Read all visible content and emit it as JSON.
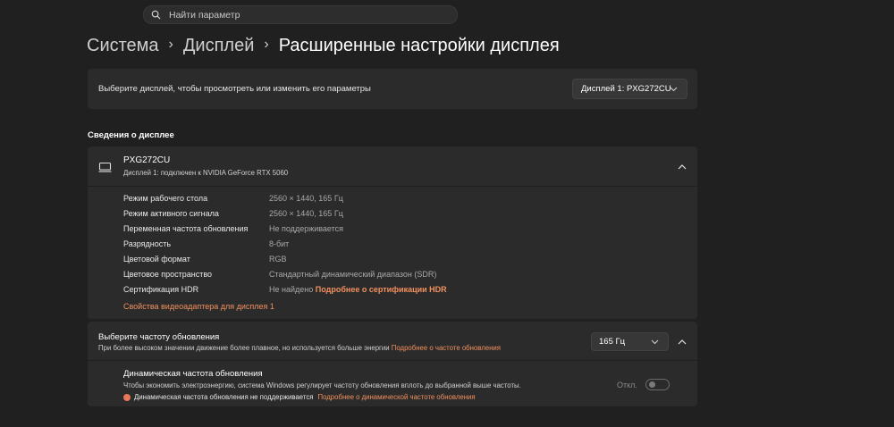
{
  "search": {
    "placeholder": "Найти параметр",
    "icon": "search-icon"
  },
  "breadcrumb": {
    "items": [
      "Система",
      "Дисплей"
    ],
    "current": "Расширенные настройки дисплея",
    "separator": "›"
  },
  "select_display": {
    "label": "Выберите дисплей, чтобы просмотреть или изменить его параметры",
    "value": "Дисплей 1: PXG272CU"
  },
  "display_info": {
    "section_title": "Сведения о дисплее",
    "name": "PXG272CU",
    "subtitle": "Дисплей 1: подключен к NVIDIA GeForce RTX 5060",
    "rows": [
      {
        "key": "Режим рабочего стола",
        "value": "2560 × 1440, 165 Гц"
      },
      {
        "key": "Режим активного сигнала",
        "value": "2560 × 1440, 165 Гц"
      },
      {
        "key": "Переменная частота обновления",
        "value": "Не поддерживается"
      },
      {
        "key": "Разрядность",
        "value": "8-бит"
      },
      {
        "key": "Цветовой формат",
        "value": "RGB"
      },
      {
        "key": "Цветовое пространство",
        "value": "Стандартный динамический диапазон (SDR)"
      },
      {
        "key": "Сертификация HDR",
        "value": "Не найдено",
        "link": "Подробнее о сертификации HDR"
      }
    ],
    "adapter_link": "Свойства видеоадаптера для дисплея 1"
  },
  "refresh": {
    "title": "Выберите частоту обновления",
    "description": "При более высоком значении движение более плавное, но используется больше энергии",
    "link": "Подробнее о частоте обновления",
    "value": "165 Гц",
    "dynamic": {
      "title": "Динамическая частота обновления",
      "description": "Чтобы экономить электроэнергию, система Windows регулирует частоту обновления вплоть до выбранной выше частоты.",
      "warning": "Динамическая частота обновления не поддерживается",
      "warning_link": "Подробнее о динамической частоте обновления",
      "toggle_label": "Откл."
    }
  },
  "colors": {
    "background": "#202020",
    "card": "#2b2b2b",
    "accent": "#f2905e",
    "warning": "#e8775a"
  }
}
